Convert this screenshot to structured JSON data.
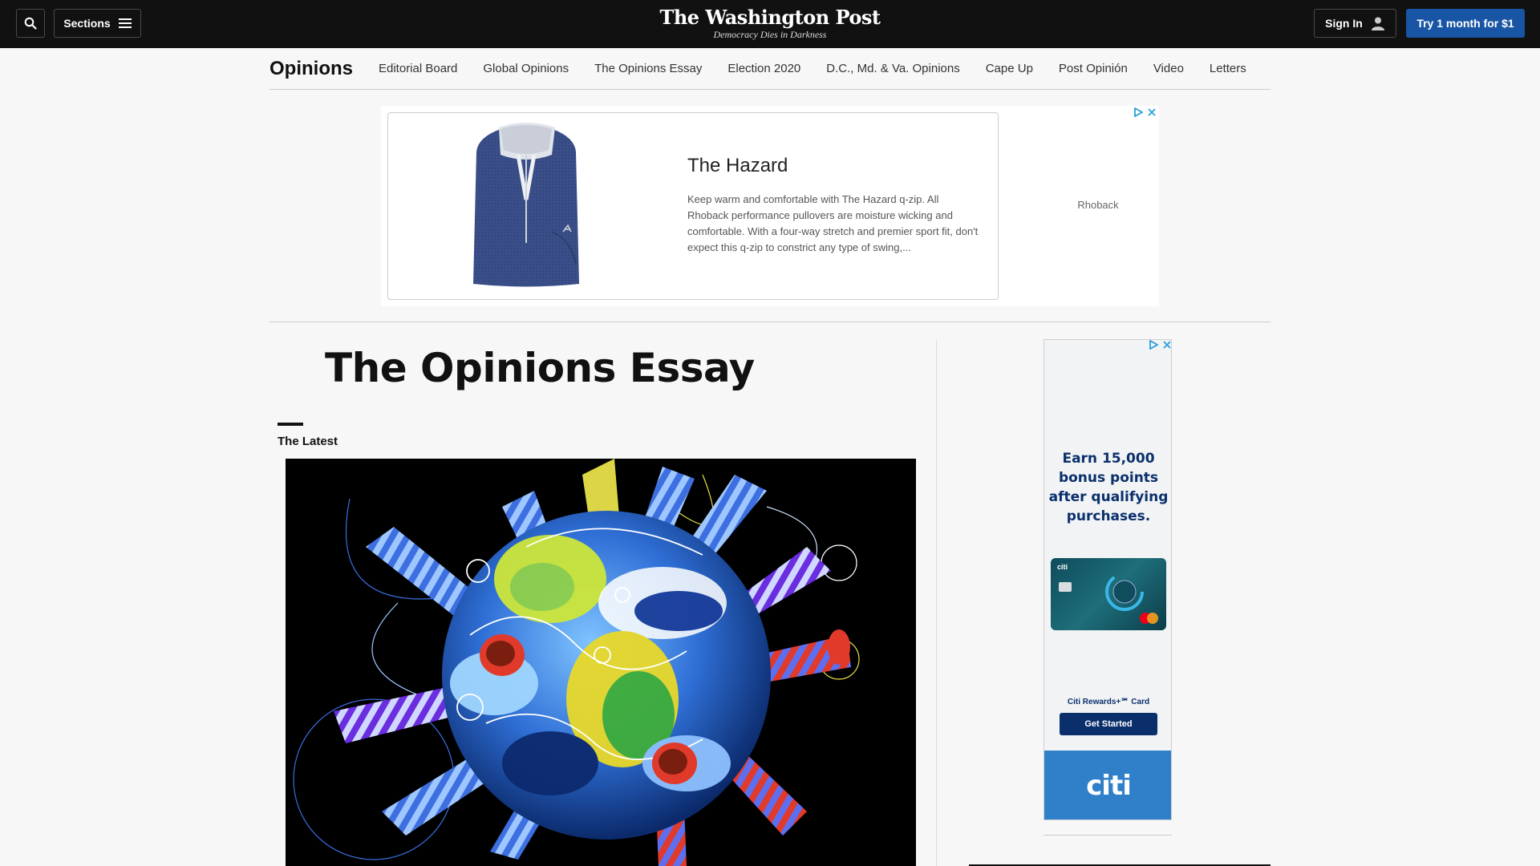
{
  "header": {
    "sections_label": "Sections",
    "logo_name": "The Washington Post",
    "logo_tagline": "Democracy Dies in Darkness",
    "signin_label": "Sign In",
    "try_label": "Try 1 month for $1",
    "icons": [
      "search-icon",
      "menu-icon",
      "user-icon"
    ],
    "accent_color": "#1955a5"
  },
  "nav": {
    "title": "Opinions",
    "items": [
      {
        "label": "Editorial Board"
      },
      {
        "label": "Global Opinions"
      },
      {
        "label": "The Opinions Essay"
      },
      {
        "label": "Election 2020"
      },
      {
        "label": "D.C., Md. & Va. Opinions"
      },
      {
        "label": "Cape Up"
      },
      {
        "label": "Post Opinión"
      },
      {
        "label": "Video"
      },
      {
        "label": "Letters"
      }
    ]
  },
  "top_ad": {
    "headline": "The Hazard",
    "body": "Keep warm and comfortable with The Hazard q-zip. All Rhoback performance pullovers are moisture wicking and comfortable. With a four-way stretch and premier sport fit, don't expect this q-zip to constrict any type of swing,...",
    "sponsor": "Rhoback"
  },
  "main": {
    "page_title": "The Opinions Essay",
    "section_label": "The Latest"
  },
  "side_ad": {
    "headline": "Earn 15,000 bonus points after qualifying purchases.",
    "card_name": "Citi Rewards+℠ Card",
    "cta": "Get Started",
    "brand": "citi",
    "brand_color": "#2f80c9"
  }
}
